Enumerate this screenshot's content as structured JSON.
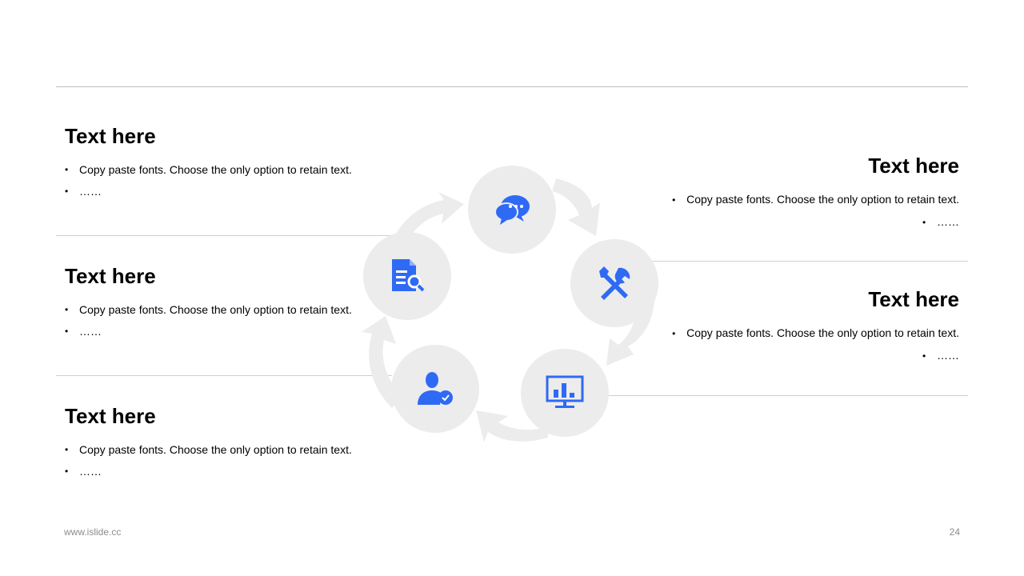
{
  "left_blocks": [
    {
      "title": "Text here",
      "bullets": [
        "Copy paste fonts. Choose the only option to retain text.",
        "……"
      ]
    },
    {
      "title": "Text here",
      "bullets": [
        "Copy paste fonts. Choose the only option to retain text.",
        "……"
      ]
    },
    {
      "title": "Text here",
      "bullets": [
        "Copy paste fonts. Choose the only option to retain text.",
        "……"
      ]
    }
  ],
  "right_blocks": [
    {
      "title": "Text here",
      "bullets": [
        "Copy paste fonts. Choose the only option to retain text.",
        "……"
      ]
    },
    {
      "title": "Text here",
      "bullets": [
        "Copy paste fonts. Choose the only option to retain text.",
        "……"
      ]
    }
  ],
  "diagram": {
    "icons": [
      "chat-icon",
      "tools-icon",
      "chart-monitor-icon",
      "user-check-icon",
      "document-search-icon"
    ],
    "icon_color": "#2f6af5",
    "circle_color": "#ececec"
  },
  "footer": {
    "website": "www.islide.cc",
    "page_number": "24"
  }
}
